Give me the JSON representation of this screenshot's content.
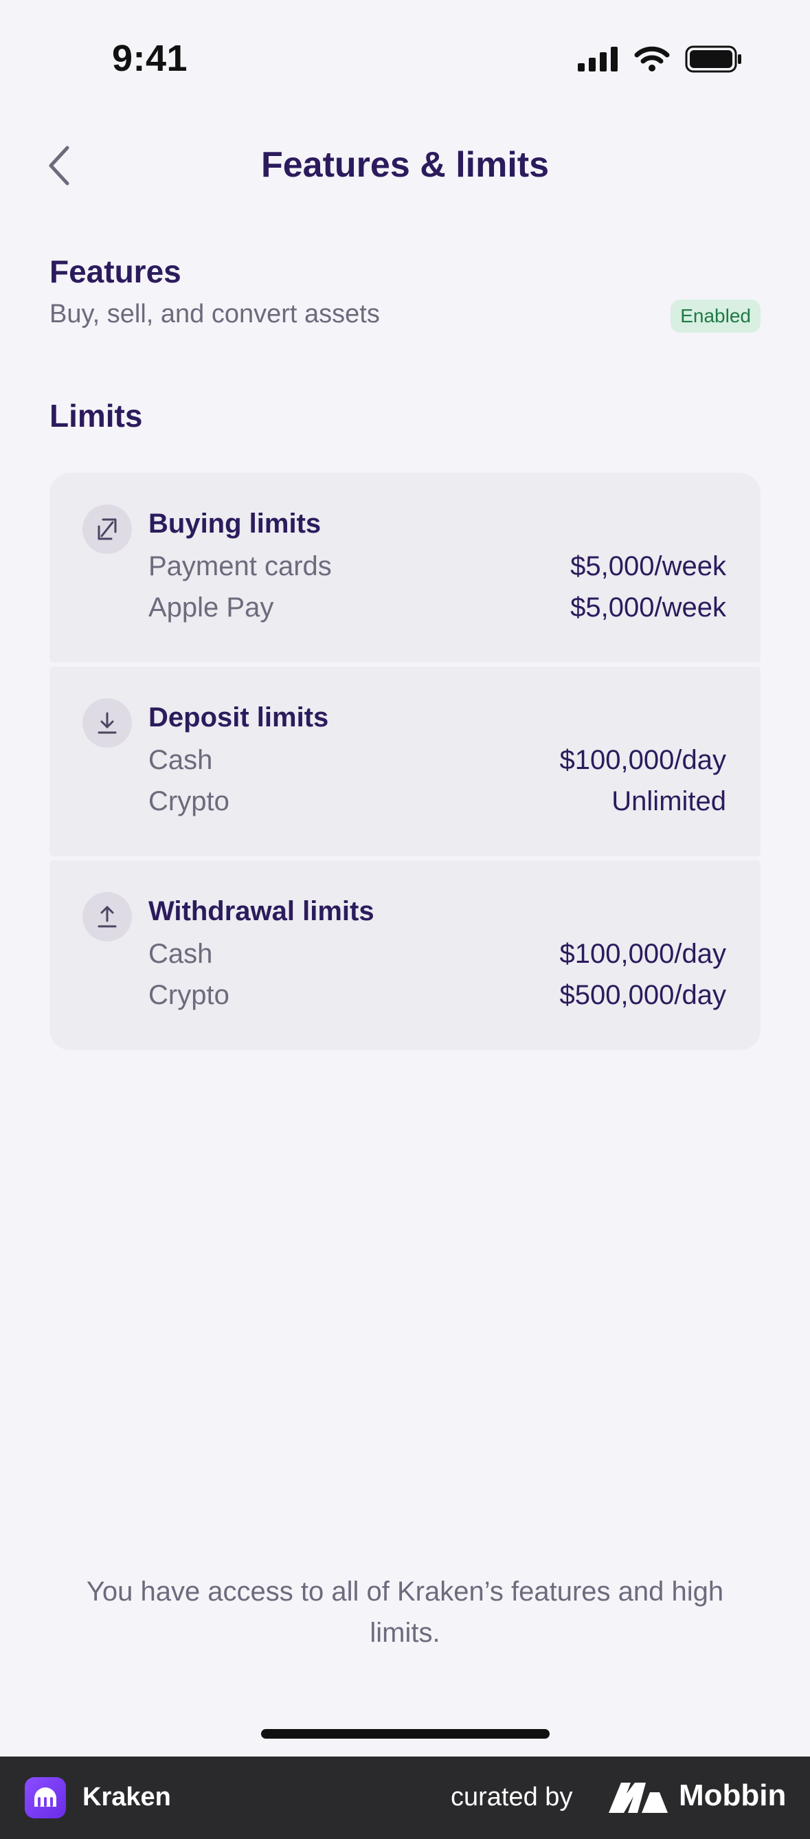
{
  "status_bar": {
    "time": "9:41"
  },
  "nav": {
    "title": "Features & limits"
  },
  "features": {
    "title": "Features",
    "description": "Buy, sell, and convert assets",
    "badge": "Enabled"
  },
  "limits": {
    "title": "Limits",
    "cards": [
      {
        "icon": "convert-arrows-icon",
        "title": "Buying limits",
        "rows": [
          {
            "label": "Payment cards",
            "value": "$5,000/week"
          },
          {
            "label": "Apple Pay",
            "value": "$5,000/week"
          }
        ]
      },
      {
        "icon": "download-arrow-icon",
        "title": "Deposit limits",
        "rows": [
          {
            "label": "Cash",
            "value": "$100,000/day"
          },
          {
            "label": "Crypto",
            "value": "Unlimited"
          }
        ]
      },
      {
        "icon": "upload-arrow-icon",
        "title": "Withdrawal limits",
        "rows": [
          {
            "label": "Cash",
            "value": "$100,000/day"
          },
          {
            "label": "Crypto",
            "value": "$500,000/day"
          }
        ]
      }
    ]
  },
  "footer_note": "You have access to all of Kraken’s features and high limits.",
  "brand_bar": {
    "app_name": "Kraken",
    "curated_by": "curated by",
    "mobbin": "Mobbin"
  },
  "colors": {
    "primary_text": "#2c1b5c",
    "secondary_text": "#6e6a7c",
    "badge_bg": "#d8efe2",
    "badge_text": "#1e7a45",
    "background": "#f5f4f9"
  }
}
